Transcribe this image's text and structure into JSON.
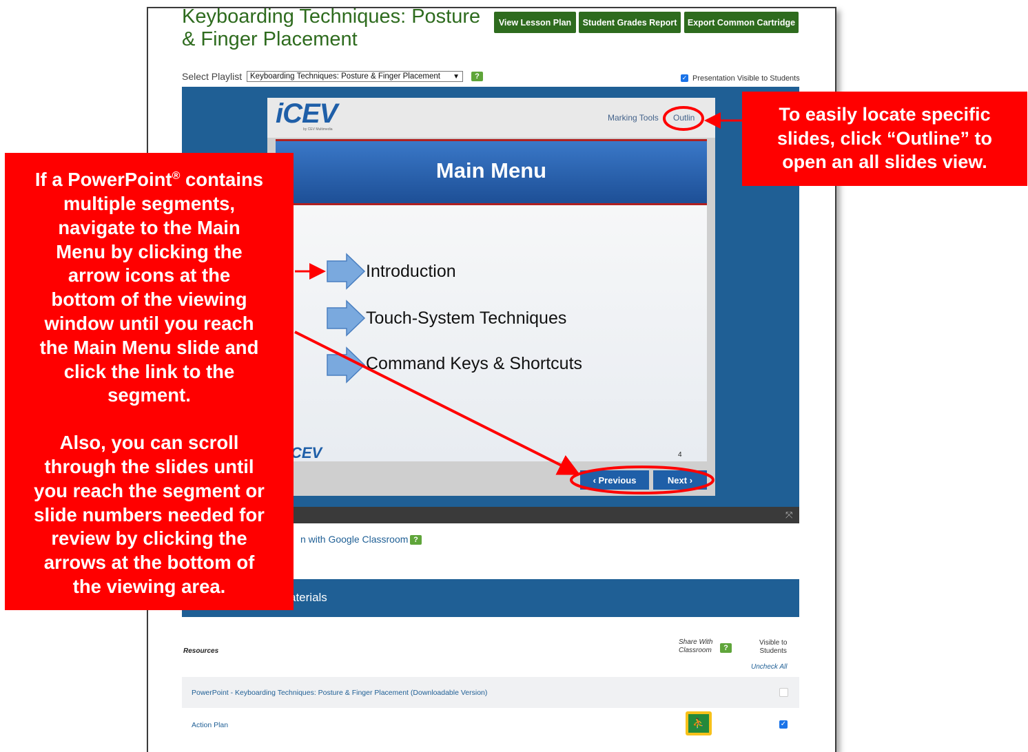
{
  "header": {
    "title": "Keyboarding Techniques: Posture & Finger Placement",
    "buttons": {
      "view_lesson_plan": "View Lesson Plan",
      "student_grades_report": "Student Grades Report",
      "export_common_cartridge": "Export Common Cartridge"
    }
  },
  "playlist": {
    "label": "Select Playlist",
    "selected": "Keyboarding Techniques: Posture & Finger Placement",
    "help_icon": "?",
    "visible_label": "Presentation Visible to Students",
    "visible_checked": true
  },
  "viewer": {
    "logo": "iCEV",
    "logo_sub": "by CEV Multimedia",
    "marking_tools": "Marking Tools",
    "outline": "Outlin",
    "slide_title": "Main Menu",
    "menu_items": [
      "Introduction",
      "Touch-System Techniques",
      "Command Keys & Shortcuts"
    ],
    "slide_logo": "CEV",
    "slide_number": "4",
    "previous": "Previous",
    "next": "Next",
    "fullscreen_icon": "fullscreen-icon"
  },
  "classroom": {
    "text": "n with Google Classroom",
    "help_icon": "?"
  },
  "materials": {
    "title": "aterials"
  },
  "resources": {
    "label": "Resources",
    "share_label_1": "Share With",
    "share_label_2": "Classroom",
    "visible_label_1": "Visible to",
    "visible_label_2": "Students",
    "uncheck_all": "Uncheck All",
    "rows": [
      {
        "name": "PowerPoint - Keyboarding Techniques: Posture & Finger Placement (Downloadable Version)",
        "visible": false
      },
      {
        "name": "Action Plan",
        "visible": true
      }
    ]
  },
  "callouts": {
    "right": [
      "To easily locate specific",
      "slides, click “Outline” to",
      "open an all slides view."
    ],
    "left_para1_start": "If a PowerPoint",
    "left_para1_reg": "®",
    "left_para1_end": " contains",
    "left_para1_lines": [
      "multiple segments,",
      "navigate to the Main",
      "Menu by clicking the",
      "arrow icons at the",
      "bottom of the viewing",
      "window until you reach",
      "the Main Menu slide and",
      "click the link to the",
      "segment."
    ],
    "left_para2_lines": [
      "Also, you can scroll",
      "through the slides until",
      "you reach the segment or",
      "slide numbers needed for",
      "review by clicking the",
      "arrows at the bottom of",
      "the viewing area."
    ]
  },
  "colors": {
    "brand_green": "#2e6b1e",
    "brand_blue": "#1f5f95",
    "callout_red": "#ff0000"
  }
}
